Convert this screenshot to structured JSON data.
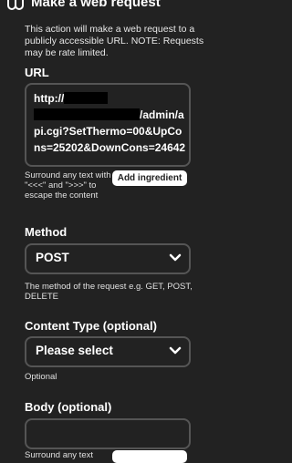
{
  "header": {
    "title": "Make a web request",
    "icon": "link-icon"
  },
  "description": "This action will make a web request to a publicly accessible URL. NOTE: Requests may be rate limited.",
  "url_field": {
    "label": "URL",
    "value_start": "http://",
    "value_mid": "/admin",
    "value_end": "/api.cgi?SetThermo=00&UpCons=25202&DownCons=24642",
    "helper": "Surround any text with \"<<<\" and \">>>\" to escape the content",
    "add_ingredient_label": "Add ingredient"
  },
  "method_field": {
    "label": "Method",
    "value": "POST",
    "helper": "The method of the request e.g. GET, POST, DELETE"
  },
  "content_type_field": {
    "label": "Content Type (optional)",
    "value": "Please select",
    "helper": "Optional"
  },
  "body_field": {
    "label": "Body (optional)",
    "helper": "Surround any text"
  },
  "colors": {
    "background": "#222222",
    "border": "#555555",
    "text": "#ffffff"
  }
}
